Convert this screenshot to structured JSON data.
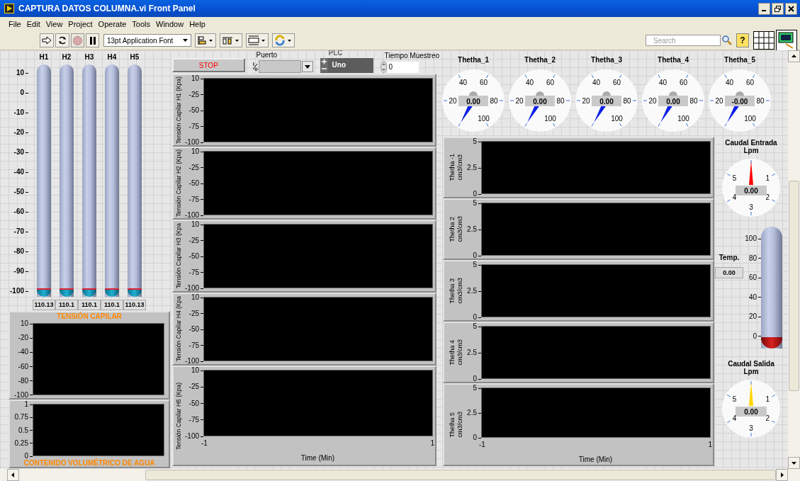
{
  "window": {
    "title": "CAPTURA DATOS COLUMNA.vi Front Panel"
  },
  "menu": [
    "File",
    "Edit",
    "View",
    "Project",
    "Operate",
    "Tools",
    "Window",
    "Help"
  ],
  "toolbar": {
    "font": "13pt Application Font",
    "search": {
      "placeholder": "Search"
    },
    "help": "?"
  },
  "tanks": {
    "scale": [
      "10",
      "0",
      "-10",
      "-20",
      "-30",
      "-40",
      "-50",
      "-60",
      "-70",
      "-80",
      "-90",
      "-100"
    ],
    "items": [
      {
        "label": "H1",
        "level": 0,
        "value": "110.13"
      },
      {
        "label": "H2",
        "level": 0,
        "value": "110.1"
      },
      {
        "label": "H3",
        "level": 0,
        "value": "110.1"
      },
      {
        "label": "H4",
        "level": 0,
        "value": "110.1"
      },
      {
        "label": "H5",
        "level": 0,
        "value": "110.13"
      }
    ]
  },
  "left_charts": [
    {
      "title": "TENSIÓN CAPILAR",
      "yticks": [
        "10",
        "-20",
        "-40",
        "-60",
        "-80",
        "-100"
      ]
    },
    {
      "title": "CONTENIDO VOLUMÉTRICO DE AGUA",
      "yticks": [
        "1",
        "0.75",
        "0.5",
        "0.25",
        "0"
      ]
    }
  ],
  "controls": {
    "stop": "STOP",
    "puerto": {
      "label": "Puerto"
    },
    "plc": {
      "label": "PLC",
      "value": "Uno"
    },
    "tiempo": {
      "label": "Tiempo Muestreo",
      "value": "0"
    }
  },
  "tension_charts": {
    "charts": [
      {
        "ylabel": "Tensión Capilar H1  (Kpa)",
        "yticks": [
          "10",
          "-25",
          "-50",
          "-75",
          "-100"
        ]
      },
      {
        "ylabel": "Tensión Capilar H2  (Kpa)",
        "yticks": [
          "10",
          "-25",
          "-50",
          "-75",
          "-100"
        ]
      },
      {
        "ylabel": "Tensión Capilar H3  (Kpa",
        "yticks": [
          "10",
          "-25",
          "-50",
          "-75",
          "-100"
        ]
      },
      {
        "ylabel": "Tensión Capilar H4  (Kpa",
        "yticks": [
          "10",
          "-25",
          "-50",
          "-75",
          "-100"
        ]
      },
      {
        "ylabel": "Tensión Capilar H5  (Kpa)",
        "yticks": [
          "10",
          "-25",
          "-50",
          "-75",
          "-100"
        ]
      }
    ],
    "xticks": [
      "-1",
      "1"
    ],
    "xlabel": "Time (Min)"
  },
  "theta_gauges": [
    {
      "label": "Thetha_1",
      "value": "0.00",
      "scale": [
        "20",
        "40",
        "60",
        "80",
        "100"
      ]
    },
    {
      "label": "Thetha_2",
      "value": "0.00",
      "scale": [
        "20",
        "40",
        "60",
        "80",
        "100"
      ]
    },
    {
      "label": "Thetha_3",
      "value": "0.00",
      "scale": [
        "20",
        "40",
        "60",
        "80",
        "100"
      ]
    },
    {
      "label": "Thetha_4",
      "value": "0.00",
      "scale": [
        "20",
        "40",
        "60",
        "80",
        "100"
      ]
    },
    {
      "label": "Thetha_5",
      "value": "-0.00",
      "scale": [
        "20",
        "40",
        "60",
        "80",
        "100"
      ]
    }
  ],
  "theta_charts": {
    "charts": [
      {
        "ylabel": "Thetha -1",
        "unit": "cm3/cm3",
        "yticks": [
          "5",
          "2.5",
          "0"
        ]
      },
      {
        "ylabel": "Thetha 2",
        "unit": "cm3/cm3",
        "yticks": [
          "5",
          "2.5",
          "0"
        ]
      },
      {
        "ylabel": "Thetha 3",
        "unit": "cm3/cm3",
        "yticks": [
          "5",
          "2.5",
          "0"
        ]
      },
      {
        "ylabel": "Thetha 4",
        "unit": "cm3/cm3",
        "yticks": [
          "5",
          "2.5",
          "0"
        ]
      },
      {
        "ylabel": "Thetha 5",
        "unit": "cm3/cm3",
        "yticks": [
          "5",
          "2.5",
          "0"
        ]
      }
    ],
    "xticks": [
      "-1",
      "1"
    ],
    "xlabel": "Time (Min)"
  },
  "flow_gauges": [
    {
      "label": "Caudal Entrada",
      "unit": "Lpm",
      "value": "0.00",
      "color": "#ff0000",
      "scale": [
        "1",
        "2",
        "3",
        "4",
        "5"
      ]
    },
    {
      "label": "Caudal Salida",
      "unit": "Lpm",
      "value": "0.00",
      "color": "#ffd700",
      "scale": [
        "1",
        "2",
        "3",
        "4",
        "5"
      ]
    }
  ],
  "temperature": {
    "label": "Temp.",
    "value": "0.00",
    "scale": [
      "100",
      "80",
      "60",
      "40",
      "20",
      "0"
    ]
  }
}
